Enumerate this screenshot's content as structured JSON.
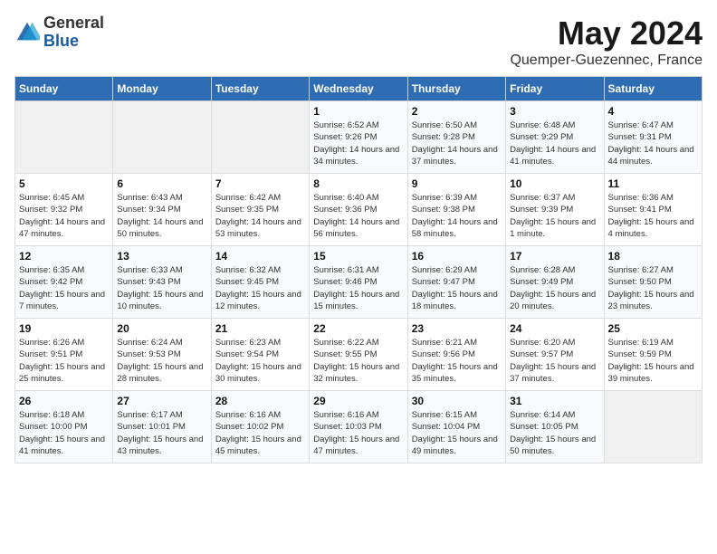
{
  "header": {
    "logo_general": "General",
    "logo_blue": "Blue",
    "month": "May 2024",
    "location": "Quemper-Guezennec, France"
  },
  "days_of_week": [
    "Sunday",
    "Monday",
    "Tuesday",
    "Wednesday",
    "Thursday",
    "Friday",
    "Saturday"
  ],
  "weeks": [
    [
      {
        "day": "",
        "empty": true
      },
      {
        "day": "",
        "empty": true
      },
      {
        "day": "",
        "empty": true
      },
      {
        "day": "1",
        "sunrise": "6:52 AM",
        "sunset": "9:26 PM",
        "daylight": "14 hours and 34 minutes."
      },
      {
        "day": "2",
        "sunrise": "6:50 AM",
        "sunset": "9:28 PM",
        "daylight": "14 hours and 37 minutes."
      },
      {
        "day": "3",
        "sunrise": "6:48 AM",
        "sunset": "9:29 PM",
        "daylight": "14 hours and 41 minutes."
      },
      {
        "day": "4",
        "sunrise": "6:47 AM",
        "sunset": "9:31 PM",
        "daylight": "14 hours and 44 minutes."
      }
    ],
    [
      {
        "day": "5",
        "sunrise": "6:45 AM",
        "sunset": "9:32 PM",
        "daylight": "14 hours and 47 minutes."
      },
      {
        "day": "6",
        "sunrise": "6:43 AM",
        "sunset": "9:34 PM",
        "daylight": "14 hours and 50 minutes."
      },
      {
        "day": "7",
        "sunrise": "6:42 AM",
        "sunset": "9:35 PM",
        "daylight": "14 hours and 53 minutes."
      },
      {
        "day": "8",
        "sunrise": "6:40 AM",
        "sunset": "9:36 PM",
        "daylight": "14 hours and 56 minutes."
      },
      {
        "day": "9",
        "sunrise": "6:39 AM",
        "sunset": "9:38 PM",
        "daylight": "14 hours and 58 minutes."
      },
      {
        "day": "10",
        "sunrise": "6:37 AM",
        "sunset": "9:39 PM",
        "daylight": "15 hours and 1 minute."
      },
      {
        "day": "11",
        "sunrise": "6:36 AM",
        "sunset": "9:41 PM",
        "daylight": "15 hours and 4 minutes."
      }
    ],
    [
      {
        "day": "12",
        "sunrise": "6:35 AM",
        "sunset": "9:42 PM",
        "daylight": "15 hours and 7 minutes."
      },
      {
        "day": "13",
        "sunrise": "6:33 AM",
        "sunset": "9:43 PM",
        "daylight": "15 hours and 10 minutes."
      },
      {
        "day": "14",
        "sunrise": "6:32 AM",
        "sunset": "9:45 PM",
        "daylight": "15 hours and 12 minutes."
      },
      {
        "day": "15",
        "sunrise": "6:31 AM",
        "sunset": "9:46 PM",
        "daylight": "15 hours and 15 minutes."
      },
      {
        "day": "16",
        "sunrise": "6:29 AM",
        "sunset": "9:47 PM",
        "daylight": "15 hours and 18 minutes."
      },
      {
        "day": "17",
        "sunrise": "6:28 AM",
        "sunset": "9:49 PM",
        "daylight": "15 hours and 20 minutes."
      },
      {
        "day": "18",
        "sunrise": "6:27 AM",
        "sunset": "9:50 PM",
        "daylight": "15 hours and 23 minutes."
      }
    ],
    [
      {
        "day": "19",
        "sunrise": "6:26 AM",
        "sunset": "9:51 PM",
        "daylight": "15 hours and 25 minutes."
      },
      {
        "day": "20",
        "sunrise": "6:24 AM",
        "sunset": "9:53 PM",
        "daylight": "15 hours and 28 minutes."
      },
      {
        "day": "21",
        "sunrise": "6:23 AM",
        "sunset": "9:54 PM",
        "daylight": "15 hours and 30 minutes."
      },
      {
        "day": "22",
        "sunrise": "6:22 AM",
        "sunset": "9:55 PM",
        "daylight": "15 hours and 32 minutes."
      },
      {
        "day": "23",
        "sunrise": "6:21 AM",
        "sunset": "9:56 PM",
        "daylight": "15 hours and 35 minutes."
      },
      {
        "day": "24",
        "sunrise": "6:20 AM",
        "sunset": "9:57 PM",
        "daylight": "15 hours and 37 minutes."
      },
      {
        "day": "25",
        "sunrise": "6:19 AM",
        "sunset": "9:59 PM",
        "daylight": "15 hours and 39 minutes."
      }
    ],
    [
      {
        "day": "26",
        "sunrise": "6:18 AM",
        "sunset": "10:00 PM",
        "daylight": "15 hours and 41 minutes."
      },
      {
        "day": "27",
        "sunrise": "6:17 AM",
        "sunset": "10:01 PM",
        "daylight": "15 hours and 43 minutes."
      },
      {
        "day": "28",
        "sunrise": "6:16 AM",
        "sunset": "10:02 PM",
        "daylight": "15 hours and 45 minutes."
      },
      {
        "day": "29",
        "sunrise": "6:16 AM",
        "sunset": "10:03 PM",
        "daylight": "15 hours and 47 minutes."
      },
      {
        "day": "30",
        "sunrise": "6:15 AM",
        "sunset": "10:04 PM",
        "daylight": "15 hours and 49 minutes."
      },
      {
        "day": "31",
        "sunrise": "6:14 AM",
        "sunset": "10:05 PM",
        "daylight": "15 hours and 50 minutes."
      },
      {
        "day": "",
        "empty": true
      }
    ]
  ],
  "labels": {
    "sunrise_prefix": "Sunrise: ",
    "sunset_prefix": "Sunset: ",
    "daylight_prefix": "Daylight: "
  }
}
